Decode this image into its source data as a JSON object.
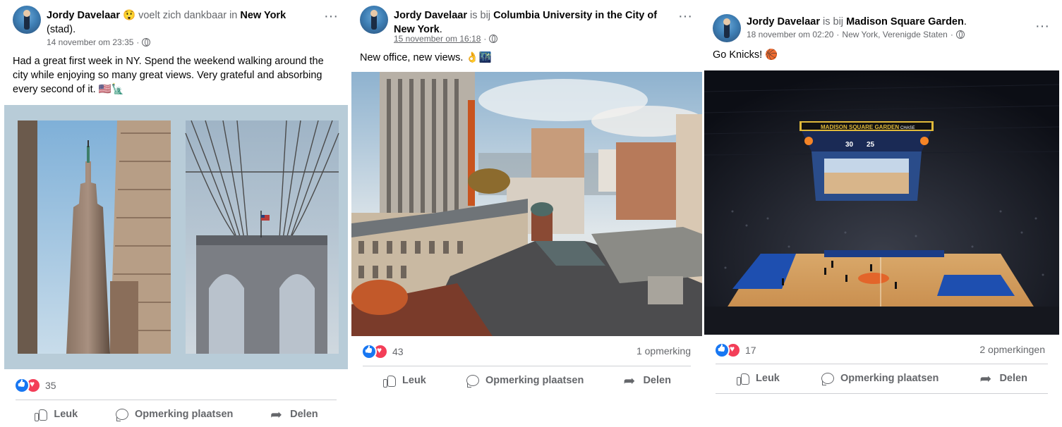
{
  "posts": [
    {
      "author": "Jordy Davelaar",
      "feeling_emoji": "😲",
      "action_text": " voelt zich dankbaar in ",
      "place": "New York",
      "place_suffix": " (stad).",
      "date": "14 november om 23:35",
      "text": "Had a great first week in NY. Spend the weekend walking around the city while enjoying so many great views. Very grateful and absorbing every second of it. 🇺🇸🗽",
      "reaction_count": "35",
      "comment_count": "",
      "actions": {
        "like": "Leuk",
        "comment": "Opmerking plaatsen",
        "share": "Delen"
      }
    },
    {
      "author": "Jordy Davelaar",
      "action_text": " is bij ",
      "place": "Columbia University in the City of New York",
      "place_suffix": ".",
      "date": "15 november om 16:18",
      "text": "New office, new views. 👌🌃",
      "reaction_count": "43",
      "comment_count": "1 opmerking",
      "actions": {
        "like": "Leuk",
        "comment": "Opmerking plaatsen",
        "share": "Delen"
      }
    },
    {
      "author": "Jordy Davelaar",
      "action_text": " is bij ",
      "place": "Madison Square Garden",
      "place_suffix": ".",
      "date": "18 november om 02:20",
      "location": "New York, Verenigde Staten",
      "text": "Go Knicks! 🏀",
      "reaction_count": "17",
      "comment_count": "2 opmerkingen",
      "actions": {
        "like": "Leuk",
        "comment": "Opmerking plaatsen",
        "share": "Delen"
      },
      "scoreboard": {
        "banner": "MADISON SQUARE GARDEN",
        "sponsor": "CHASE",
        "score_home": "30",
        "score_away": "25"
      }
    }
  ],
  "colors": {
    "like_blue": "#1877f2",
    "love_red": "#f33e58",
    "secondary_text": "#65676b",
    "divider": "#ced0d4",
    "photo_frame": "#b8ccd8"
  }
}
